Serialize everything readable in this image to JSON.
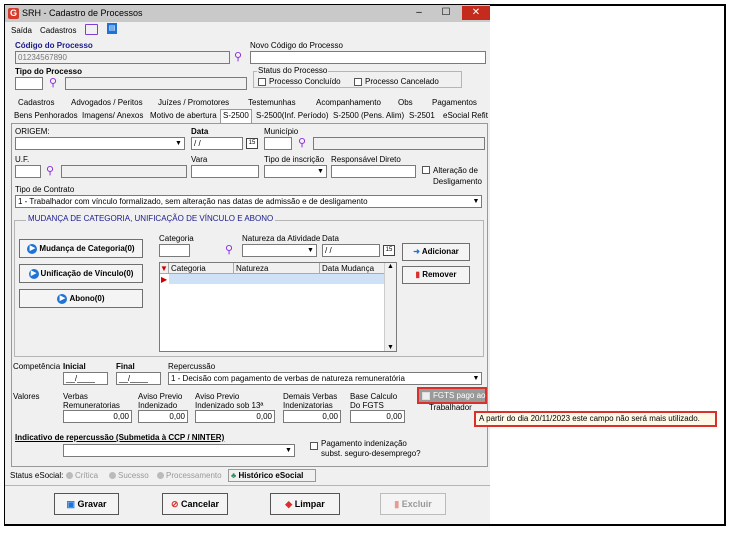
{
  "window": {
    "title": "SRH - Cadastro de Processos",
    "minimize": "–",
    "maximize": "☐",
    "close": "✕"
  },
  "menu": {
    "saida": "Saída",
    "cadastros": "Cadastros"
  },
  "header": {
    "codigo_label": "Código do Processo",
    "codigo_value": "01234567890",
    "novo_codigo_label": "Novo Código do Processo",
    "tipo_label": "Tipo do Processo",
    "status_label": "Status do Processo",
    "concluido_label": "Processo Concluído",
    "cancelado_label": "Processo Cancelado"
  },
  "tabs_row1": [
    "Cadastros",
    "Advogados / Peritos",
    "Juízes / Promotores",
    "Testemunhas",
    "Acompanhamento",
    "Obs",
    "Pagamentos"
  ],
  "tabs_row2": [
    "Bens Penhorados",
    "Imagens/ Anexos",
    "Motivo de abertura",
    "S-2500",
    "S-2500(Inf. Período)",
    "S-2500 (Pens. Alim)",
    "S-2501",
    "eSocial Refit"
  ],
  "form": {
    "origem_label": "ORIGEM:",
    "data_label": "Data",
    "data_value": " / /",
    "municipio_label": "Município",
    "uf_label": "U.F.",
    "vara_label": "Vara",
    "tipo_inscricao_label": "Tipo de inscrição",
    "responsavel_label": "Responsável Direto",
    "alteracao_label": "Alteração de Desligamento",
    "tipo_contrato_label": "Tipo de Contrato",
    "tipo_contrato_value": "1 - Trabalhador com vínculo formalizado, sem alteração nas datas de admissão e de desligamento"
  },
  "mudanca": {
    "title": "MUDANÇA DE CATEGORIA, UNIFICAÇÃO DE VÍNCULO E ABONO",
    "btn_mudanca": "Mudança de Categoria(0)",
    "btn_unificacao": "Unificação de Vínculo(0)",
    "btn_abono": "Abono(0)",
    "categoria_label": "Categoria",
    "natureza_label": "Natureza da Atividade",
    "data_label": "Data",
    "data_value": " / /",
    "btn_adicionar": "Adicionar",
    "btn_remover": "Remover",
    "grid_headers": [
      "Categoria",
      "Natureza",
      "Data Mudança"
    ]
  },
  "competencia": {
    "label": "Competência",
    "inicial_label": "Inicial",
    "inicial_value": "__/____",
    "final_label": "Final",
    "final_value": "__/____",
    "repercussao_label": "Repercussão",
    "repercussao_value": "1 - Decisão com pagamento de verbas de natureza remuneratória"
  },
  "valores": {
    "label": "Valores",
    "verbas_label": "Verbas Remuneratorias",
    "verbas_value": "0,00",
    "aviso_label": "Aviso Previo Indenizado",
    "aviso_value": "0,00",
    "aviso13_label": "Aviso Previo Indenizado sob 13ª",
    "aviso13_value": "0,00",
    "demais_label": "Demais Verbas Indenizatorias",
    "demais_value": "0,00",
    "base_label": "Base Calculo Do FGTS",
    "base_value": "0,00",
    "fgts_label": "FGTS pago ao Trabalhador",
    "tooltip": "A partir do dia 20/11/2023 este campo não será mais utilizado."
  },
  "indicativo": {
    "label": "Indicativo de repercussão (Submetida à CCP / NINTER)",
    "pagamento_label": "Pagamento indenização subst. seguro-desemprego?"
  },
  "status_esocial": {
    "label": "Status eSocial:",
    "critica": "Crítica",
    "sucesso": "Sucesso",
    "processamento": "Processamento",
    "historico": "Histórico eSocial"
  },
  "footer": {
    "gravar": "Gravar",
    "cancelar": "Cancelar",
    "limpar": "Limpar",
    "excluir": "Excluir"
  },
  "colors": {
    "accent": "#1e73d8",
    "highlight": "#d9302b",
    "titlebar": "#c9c9c9"
  }
}
